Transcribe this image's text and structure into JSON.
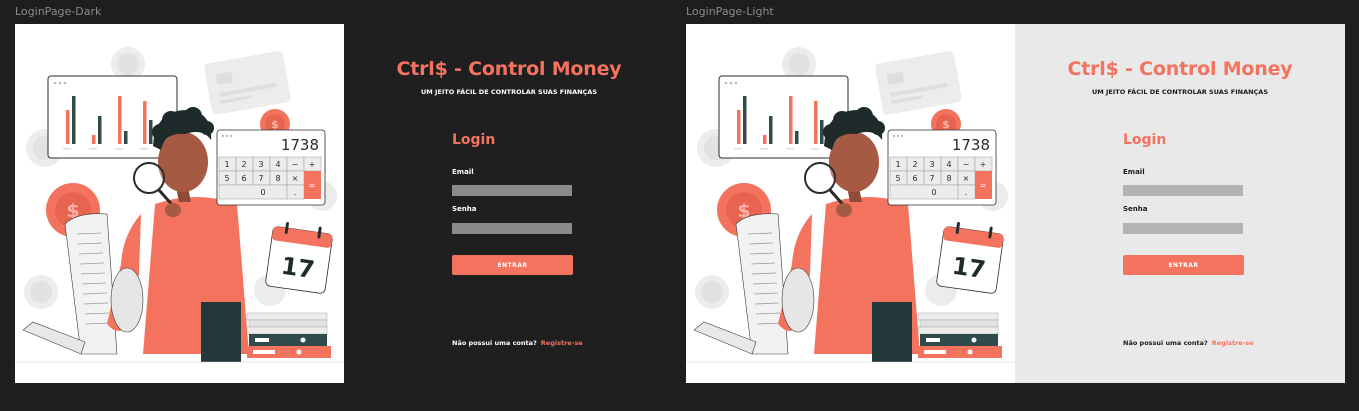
{
  "frames": [
    {
      "id": "dark",
      "label": "LoginPage-Dark",
      "theme": "dark",
      "panel_bg": "#1f1f1f",
      "text_color": "#ffffff",
      "field_color": "#8a8a8a"
    },
    {
      "id": "light",
      "label": "LoginPage-Light",
      "theme": "light",
      "panel_bg": "#e9e9e9",
      "text_color": "#1a1a1a",
      "field_color": "#b3b3b3"
    }
  ],
  "brand": {
    "title": "Ctrl$ - Control Money",
    "subtitle": "UM JEITO FÁCIL DE CONTROLAR SUAS FINANÇAS"
  },
  "login": {
    "heading": "Login",
    "email_label": "Email",
    "email_value": "",
    "password_label": "Senha",
    "password_value": "",
    "submit_label": "ENTRAR"
  },
  "signup": {
    "prompt": "Não possui uma conta?",
    "link": "Registre-se"
  },
  "illustration": {
    "calculator_display": "1738",
    "calculator_keys": [
      "1",
      "2",
      "3",
      "4",
      "−",
      "+",
      "5",
      "6",
      "7",
      "8",
      "×",
      "=",
      "0",
      "."
    ],
    "calendar_day": "17"
  },
  "colors": {
    "accent": "#f4735f",
    "dark_bar": "#2f4a4a",
    "canvas": "#1e1e1e"
  }
}
